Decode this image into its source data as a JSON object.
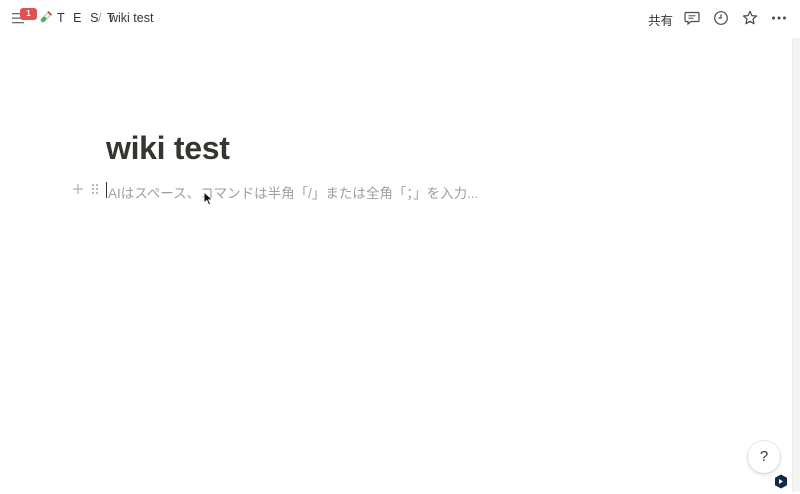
{
  "topbar": {
    "notification_count": "1",
    "workspace_icon": "test-tube-icon",
    "workspace": "T E S T",
    "separator": "/",
    "page": "wiki test",
    "share_label": "共有",
    "icons": [
      "menu-icon",
      "comment-icon",
      "clock-icon",
      "star-icon",
      "more-icon"
    ]
  },
  "page": {
    "title": "wiki test",
    "placeholder": "AIはスペース、コマンドは半角「/」または全角「；」を入力..."
  },
  "help": {
    "label": "?"
  },
  "colors": {
    "text": "#37352f",
    "placeholder": "#a19f9a",
    "badge": "#e0524f"
  }
}
